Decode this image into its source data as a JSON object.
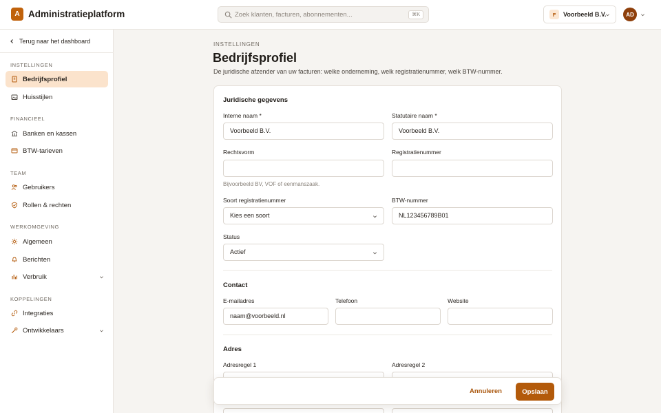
{
  "header": {
    "logo_letter": "A",
    "app_title": "Administratieplatform",
    "search_placeholder": "Zoek klanten, facturen, abonnementen...",
    "search_shortcut": "⌘K",
    "org_badge": "F",
    "org_name": "Voorbeeld B.V.",
    "avatar_initials": "AD"
  },
  "sidebar": {
    "back_label": "Terug naar het dashboard",
    "sections": [
      {
        "label": "INSTELLINGEN",
        "items": [
          {
            "label": "Bedrijfsprofiel",
            "icon": "building-icon",
            "active": true
          },
          {
            "label": "Huisstijlen",
            "icon": "image-icon"
          }
        ]
      },
      {
        "label": "FINANCIEEL",
        "items": [
          {
            "label": "Banken en kassen",
            "icon": "bank-icon"
          },
          {
            "label": "BTW-tarieven",
            "icon": "card-icon"
          }
        ]
      },
      {
        "label": "TEAM",
        "items": [
          {
            "label": "Gebruikers",
            "icon": "users-icon"
          },
          {
            "label": "Rollen & rechten",
            "icon": "shield-icon"
          }
        ]
      },
      {
        "label": "WERKOMGEVING",
        "items": [
          {
            "label": "Algemeen",
            "icon": "gear-icon"
          },
          {
            "label": "Berichten",
            "icon": "bell-icon"
          },
          {
            "label": "Verbruik",
            "icon": "bar-chart-icon",
            "expandable": true
          }
        ]
      },
      {
        "label": "KOPPELINGEN",
        "items": [
          {
            "label": "Integraties",
            "icon": "link-icon"
          },
          {
            "label": "Ontwikkelaars",
            "icon": "wrench-icon",
            "expandable": true
          }
        ]
      }
    ]
  },
  "page": {
    "kicker": "INSTELLINGEN",
    "title": "Bedrijfsprofiel",
    "subtitle": "De juridische afzender van uw facturen: welke onderneming, welk registratienummer, welk BTW-nummer."
  },
  "form": {
    "legal": {
      "title": "Juridische gegevens",
      "internal_name": {
        "label": "Interne naam *",
        "value": "Voorbeeld B.V."
      },
      "statutory_name": {
        "label": "Statutaire naam *",
        "value": "Voorbeeld B.V."
      },
      "legal_form": {
        "label": "Rechtsvorm",
        "value": "",
        "hint": "Bijvoorbeeld BV, VOF of eenmanszaak."
      },
      "registration_number": {
        "label": "Registratienummer",
        "value": ""
      },
      "registration_type": {
        "label": "Soort registratienummer",
        "value": "Kies een soort"
      },
      "vat_number": {
        "label": "BTW-nummer",
        "value": "NL123456789B01"
      },
      "status": {
        "label": "Status",
        "value": "Actief"
      }
    },
    "contact": {
      "title": "Contact",
      "email": {
        "label": "E-mailadres",
        "value": "naam@voorbeeld.nl"
      },
      "phone": {
        "label": "Telefoon",
        "value": ""
      },
      "website": {
        "label": "Website",
        "value": ""
      }
    },
    "address": {
      "title": "Adres",
      "line1": {
        "label": "Adresregel 1",
        "value": ""
      },
      "line2": {
        "label": "Adresregel 2",
        "value": ""
      }
    }
  },
  "actions": {
    "cancel_label": "Annuleren",
    "save_label": "Opslaan"
  }
}
